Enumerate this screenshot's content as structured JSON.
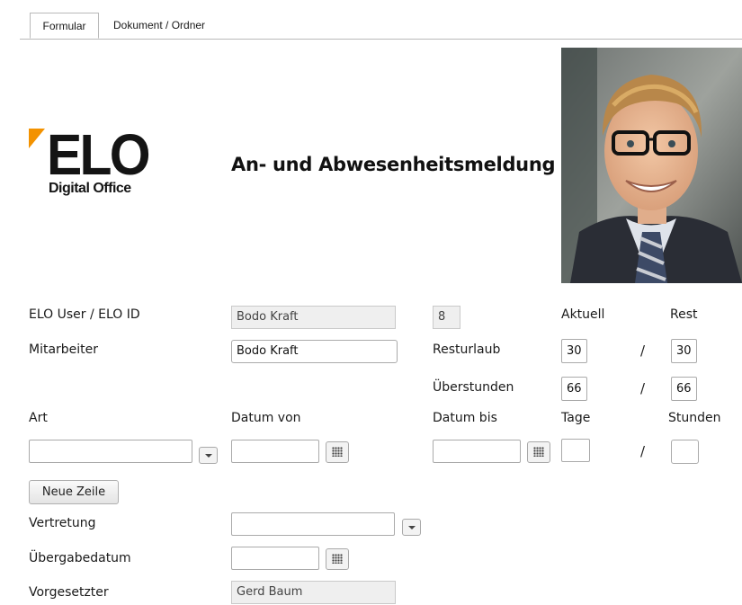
{
  "tabs": {
    "active": "Formular",
    "other": "Dokument / Ordner"
  },
  "logo": {
    "main": "ELO",
    "sub": "Digital Office",
    "accent_color": "#f39200"
  },
  "header": {
    "title": "An- und Abwesenheitsmeldung"
  },
  "photo": {
    "icon": "user-photo"
  },
  "labels": {
    "elo_user": "ELO User / ELO ID",
    "mitarbeiter": "Mitarbeiter",
    "aktuell": "Aktuell",
    "rest": "Rest",
    "resturlaub": "Resturlaub",
    "ueberstunden": "Überstunden",
    "art": "Art",
    "datum_von": "Datum von",
    "datum_bis": "Datum bis",
    "tage": "Tage",
    "stunden": "Stunden",
    "vertretung": "Vertretung",
    "uebergabedatum": "Übergabedatum",
    "vorgesetzter": "Vorgesetzter",
    "slash": "/"
  },
  "values": {
    "elo_user": "Bodo Kraft",
    "elo_id": "8",
    "mitarbeiter": "Bodo Kraft",
    "resturlaub_aktuell": "30",
    "resturlaub_rest": "30",
    "ueberstunden_aktuell": "66",
    "ueberstunden_rest": "66",
    "art": "",
    "datum_von": "",
    "datum_bis": "",
    "tage": "",
    "stunden": "",
    "vertretung": "",
    "uebergabedatum": "",
    "vorgesetzter": "Gerd Baum"
  },
  "buttons": {
    "neue_zeile": "Neue Zeile"
  }
}
